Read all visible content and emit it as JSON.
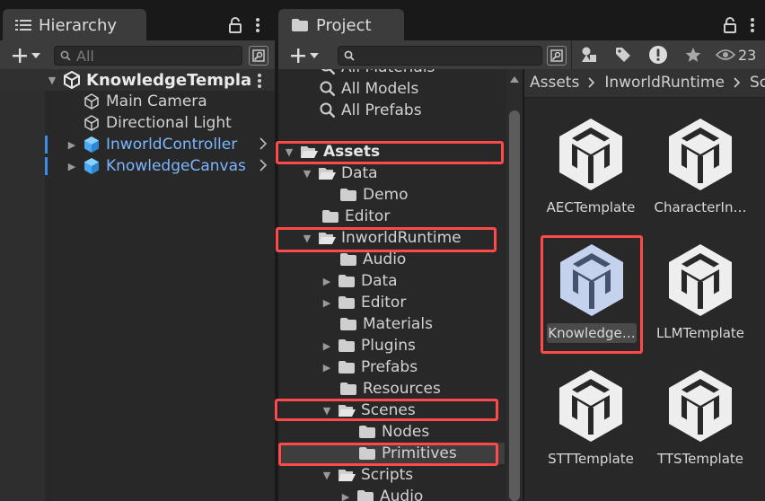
{
  "hierarchy": {
    "tab_title": "Hierarchy",
    "search_placeholder": "All",
    "scene_name": "KnowledgeTempla",
    "items": [
      {
        "label": "Main Camera"
      },
      {
        "label": "Directional Light"
      },
      {
        "label": "InworldController"
      },
      {
        "label": "KnowledgeCanvas"
      }
    ]
  },
  "project": {
    "tab_title": "Project",
    "search_placeholder": "",
    "visibility_count": "23",
    "favorites": [
      {
        "label": "All Materials"
      },
      {
        "label": "All Models"
      },
      {
        "label": "All Prefabs"
      }
    ],
    "tree": [
      {
        "label": "Assets"
      },
      {
        "label": "Data"
      },
      {
        "label": "Demo"
      },
      {
        "label": "Editor"
      },
      {
        "label": "InworldRuntime"
      },
      {
        "label": "Audio"
      },
      {
        "label": "Data"
      },
      {
        "label": "Editor"
      },
      {
        "label": "Materials"
      },
      {
        "label": "Plugins"
      },
      {
        "label": "Prefabs"
      },
      {
        "label": "Resources"
      },
      {
        "label": "Scenes"
      },
      {
        "label": "Nodes"
      },
      {
        "label": "Primitives"
      },
      {
        "label": "Scripts"
      },
      {
        "label": "Audio"
      }
    ],
    "breadcrumb": [
      "Assets",
      "InworldRuntime",
      "Sc"
    ],
    "assets": [
      {
        "label": "AECTemplate"
      },
      {
        "label": "CharacterIn…"
      },
      {
        "label": "Knowledge…"
      },
      {
        "label": "LLMTemplate"
      },
      {
        "label": "STTTemplate"
      },
      {
        "label": "TTSTemplate"
      }
    ]
  },
  "colors": {
    "highlight": "#ff4a4a",
    "link_blue": "#7cb6ff",
    "panel_bg": "#383838",
    "tree_bg": "#282828"
  }
}
